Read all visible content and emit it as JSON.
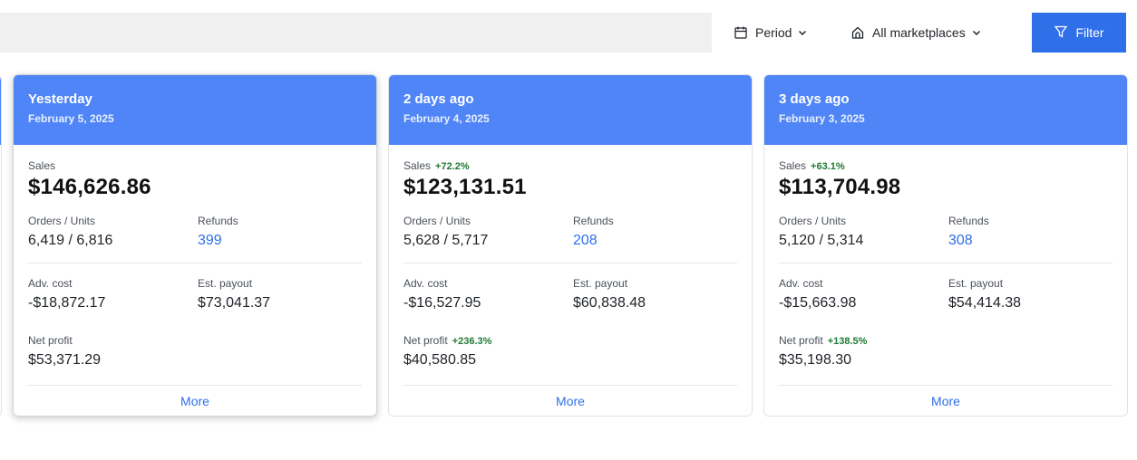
{
  "toolbar": {
    "period_label": "Period",
    "marketplace_label": "All marketplaces",
    "filter_label": "Filter"
  },
  "cards": [
    {
      "title": "Yesterday",
      "date": "February 5, 2025",
      "sales_label": "Sales",
      "sales_delta": "",
      "sales": "$146,626.86",
      "orders_label": "Orders / Units",
      "orders": "6,419 / 6,816",
      "refunds_label": "Refunds",
      "refunds": "399",
      "adv_label": "Adv. cost",
      "adv": "-$18,872.17",
      "payout_label": "Est. payout",
      "payout": "$73,041.37",
      "net_label": "Net profit",
      "net_delta": "",
      "net": "$53,371.29",
      "more_label": "More"
    },
    {
      "title": "2 days ago",
      "date": "February 4, 2025",
      "sales_label": "Sales",
      "sales_delta": "+72.2%",
      "sales": "$123,131.51",
      "orders_label": "Orders / Units",
      "orders": "5,628 / 5,717",
      "refunds_label": "Refunds",
      "refunds": "208",
      "adv_label": "Adv. cost",
      "adv": "-$16,527.95",
      "payout_label": "Est. payout",
      "payout": "$60,838.48",
      "net_label": "Net profit",
      "net_delta": "+236.3%",
      "net": "$40,580.85",
      "more_label": "More"
    },
    {
      "title": "3 days ago",
      "date": "February 3, 2025",
      "sales_label": "Sales",
      "sales_delta": "+63.1%",
      "sales": "$113,704.98",
      "orders_label": "Orders / Units",
      "orders": "5,120 / 5,314",
      "refunds_label": "Refunds",
      "refunds": "308",
      "adv_label": "Adv. cost",
      "adv": "-$15,663.98",
      "payout_label": "Est. payout",
      "payout": "$54,414.38",
      "net_label": "Net profit",
      "net_delta": "+138.5%",
      "net": "$35,198.30",
      "more_label": "More"
    }
  ],
  "colors": {
    "header_blue": "#4f85f7",
    "button_blue": "#2f6fe8",
    "link_blue": "#2f6fe8",
    "positive_green": "#1f7a33"
  },
  "icons": {
    "period": "calendar-icon",
    "marketplace": "home-icon",
    "filter": "funnel-icon",
    "chevron": "chevron-down-icon"
  }
}
